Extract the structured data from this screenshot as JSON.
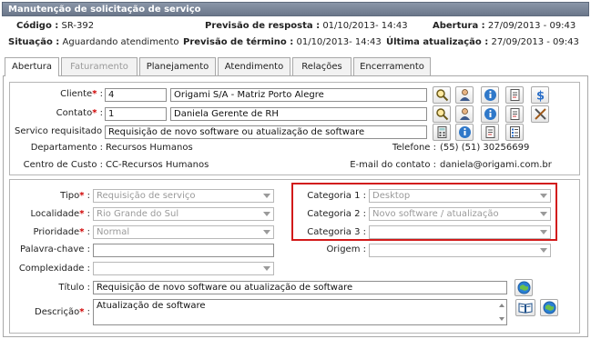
{
  "window": {
    "title": "Manutenção de solicitação de serviço"
  },
  "header": {
    "codigo_label": "Código :",
    "codigo_value": "SR-392",
    "previsao_resposta_label": "Previsão de resposta :",
    "previsao_resposta_value": "01/10/2013- 14:43",
    "abertura_label": "Abertura :",
    "abertura_value": "27/09/2013 - 09:43",
    "situacao_label": "Situação :",
    "situacao_value": "Aguardando atendimento",
    "previsao_termino_label": "Previsão de término :",
    "previsao_termino_value": "01/10/2013- 14:43",
    "ultima_atualizacao_label": "Última atualização :",
    "ultima_atualizacao_value": "27/09/2013 - 09:43"
  },
  "tabs": [
    {
      "label": "Abertura",
      "state": "active"
    },
    {
      "label": "Faturamento",
      "state": "disabled"
    },
    {
      "label": "Planejamento",
      "state": "normal"
    },
    {
      "label": "Atendimento",
      "state": "normal"
    },
    {
      "label": "Relações",
      "state": "normal"
    },
    {
      "label": "Encerramento",
      "state": "normal"
    }
  ],
  "client_section": {
    "cliente_label": "Cliente",
    "cliente_code": "4",
    "cliente_name": "Origami S/A - Matriz Porto Alegre",
    "contato_label": "Contato",
    "contato_code": "1",
    "contato_name": "Daniela Gerente de RH",
    "servico_label": "Servico requisitado :",
    "servico_value": "Requisição de novo software ou atualização de software",
    "departamento_label": "Departamento :",
    "departamento_value": "Recursos Humanos",
    "telefone_label": "Telefone :",
    "telefone_value": "(55) (51) 30256699",
    "centro_label": "Centro de Custo :",
    "centro_value": "CC-Recursos Humanos",
    "email_label": "E-mail do contato :",
    "email_value": "daniela@origami.com.br"
  },
  "detail_section": {
    "tipo_label": "Tipo",
    "tipo_value": "Requisição de serviço",
    "localidade_label": "Localidade",
    "localidade_value": "Rio Grande do Sul",
    "prioridade_label": "Prioridade",
    "prioridade_value": "Normal",
    "palavra_label": "Palavra-chave :",
    "palavra_value": "",
    "complexidade_label": "Complexidade :",
    "complexidade_value": "",
    "categoria1_label": "Categoria 1 :",
    "categoria1_value": "Desktop",
    "categoria2_label": "Categoria 2 :",
    "categoria2_value": "Novo software / atualização",
    "categoria3_label": "Categoria 3 :",
    "categoria3_value": "",
    "origem_label": "Origem :",
    "origem_value": "",
    "titulo_label": "Título :",
    "titulo_value": "Requisição de novo software ou atualização de software",
    "descricao_label": "Descrição",
    "descricao_value": "Atualização de software"
  },
  "colors": {
    "title_bar": "#6b778a",
    "required": "#d00000",
    "highlight_border": "#d21a1a",
    "globe": "#2a7fd4"
  },
  "icons": [
    "search-icon",
    "person-icon",
    "info-icon",
    "document-icon",
    "money-icon",
    "tools-icon",
    "calculator-icon",
    "list-icon",
    "globe-icon",
    "book-icon"
  ]
}
